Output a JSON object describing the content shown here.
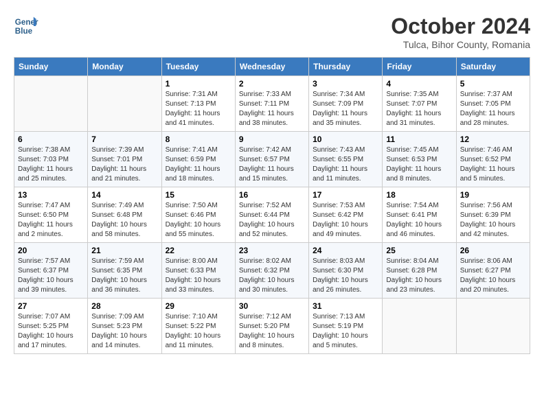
{
  "header": {
    "logo_line1": "General",
    "logo_line2": "Blue",
    "month": "October 2024",
    "location": "Tulca, Bihor County, Romania"
  },
  "weekdays": [
    "Sunday",
    "Monday",
    "Tuesday",
    "Wednesday",
    "Thursday",
    "Friday",
    "Saturday"
  ],
  "weeks": [
    [
      {
        "day": "",
        "sunrise": "",
        "sunset": "",
        "daylight": ""
      },
      {
        "day": "",
        "sunrise": "",
        "sunset": "",
        "daylight": ""
      },
      {
        "day": "1",
        "sunrise": "Sunrise: 7:31 AM",
        "sunset": "Sunset: 7:13 PM",
        "daylight": "Daylight: 11 hours and 41 minutes."
      },
      {
        "day": "2",
        "sunrise": "Sunrise: 7:33 AM",
        "sunset": "Sunset: 7:11 PM",
        "daylight": "Daylight: 11 hours and 38 minutes."
      },
      {
        "day": "3",
        "sunrise": "Sunrise: 7:34 AM",
        "sunset": "Sunset: 7:09 PM",
        "daylight": "Daylight: 11 hours and 35 minutes."
      },
      {
        "day": "4",
        "sunrise": "Sunrise: 7:35 AM",
        "sunset": "Sunset: 7:07 PM",
        "daylight": "Daylight: 11 hours and 31 minutes."
      },
      {
        "day": "5",
        "sunrise": "Sunrise: 7:37 AM",
        "sunset": "Sunset: 7:05 PM",
        "daylight": "Daylight: 11 hours and 28 minutes."
      }
    ],
    [
      {
        "day": "6",
        "sunrise": "Sunrise: 7:38 AM",
        "sunset": "Sunset: 7:03 PM",
        "daylight": "Daylight: 11 hours and 25 minutes."
      },
      {
        "day": "7",
        "sunrise": "Sunrise: 7:39 AM",
        "sunset": "Sunset: 7:01 PM",
        "daylight": "Daylight: 11 hours and 21 minutes."
      },
      {
        "day": "8",
        "sunrise": "Sunrise: 7:41 AM",
        "sunset": "Sunset: 6:59 PM",
        "daylight": "Daylight: 11 hours and 18 minutes."
      },
      {
        "day": "9",
        "sunrise": "Sunrise: 7:42 AM",
        "sunset": "Sunset: 6:57 PM",
        "daylight": "Daylight: 11 hours and 15 minutes."
      },
      {
        "day": "10",
        "sunrise": "Sunrise: 7:43 AM",
        "sunset": "Sunset: 6:55 PM",
        "daylight": "Daylight: 11 hours and 11 minutes."
      },
      {
        "day": "11",
        "sunrise": "Sunrise: 7:45 AM",
        "sunset": "Sunset: 6:53 PM",
        "daylight": "Daylight: 11 hours and 8 minutes."
      },
      {
        "day": "12",
        "sunrise": "Sunrise: 7:46 AM",
        "sunset": "Sunset: 6:52 PM",
        "daylight": "Daylight: 11 hours and 5 minutes."
      }
    ],
    [
      {
        "day": "13",
        "sunrise": "Sunrise: 7:47 AM",
        "sunset": "Sunset: 6:50 PM",
        "daylight": "Daylight: 11 hours and 2 minutes."
      },
      {
        "day": "14",
        "sunrise": "Sunrise: 7:49 AM",
        "sunset": "Sunset: 6:48 PM",
        "daylight": "Daylight: 10 hours and 58 minutes."
      },
      {
        "day": "15",
        "sunrise": "Sunrise: 7:50 AM",
        "sunset": "Sunset: 6:46 PM",
        "daylight": "Daylight: 10 hours and 55 minutes."
      },
      {
        "day": "16",
        "sunrise": "Sunrise: 7:52 AM",
        "sunset": "Sunset: 6:44 PM",
        "daylight": "Daylight: 10 hours and 52 minutes."
      },
      {
        "day": "17",
        "sunrise": "Sunrise: 7:53 AM",
        "sunset": "Sunset: 6:42 PM",
        "daylight": "Daylight: 10 hours and 49 minutes."
      },
      {
        "day": "18",
        "sunrise": "Sunrise: 7:54 AM",
        "sunset": "Sunset: 6:41 PM",
        "daylight": "Daylight: 10 hours and 46 minutes."
      },
      {
        "day": "19",
        "sunrise": "Sunrise: 7:56 AM",
        "sunset": "Sunset: 6:39 PM",
        "daylight": "Daylight: 10 hours and 42 minutes."
      }
    ],
    [
      {
        "day": "20",
        "sunrise": "Sunrise: 7:57 AM",
        "sunset": "Sunset: 6:37 PM",
        "daylight": "Daylight: 10 hours and 39 minutes."
      },
      {
        "day": "21",
        "sunrise": "Sunrise: 7:59 AM",
        "sunset": "Sunset: 6:35 PM",
        "daylight": "Daylight: 10 hours and 36 minutes."
      },
      {
        "day": "22",
        "sunrise": "Sunrise: 8:00 AM",
        "sunset": "Sunset: 6:33 PM",
        "daylight": "Daylight: 10 hours and 33 minutes."
      },
      {
        "day": "23",
        "sunrise": "Sunrise: 8:02 AM",
        "sunset": "Sunset: 6:32 PM",
        "daylight": "Daylight: 10 hours and 30 minutes."
      },
      {
        "day": "24",
        "sunrise": "Sunrise: 8:03 AM",
        "sunset": "Sunset: 6:30 PM",
        "daylight": "Daylight: 10 hours and 26 minutes."
      },
      {
        "day": "25",
        "sunrise": "Sunrise: 8:04 AM",
        "sunset": "Sunset: 6:28 PM",
        "daylight": "Daylight: 10 hours and 23 minutes."
      },
      {
        "day": "26",
        "sunrise": "Sunrise: 8:06 AM",
        "sunset": "Sunset: 6:27 PM",
        "daylight": "Daylight: 10 hours and 20 minutes."
      }
    ],
    [
      {
        "day": "27",
        "sunrise": "Sunrise: 7:07 AM",
        "sunset": "Sunset: 5:25 PM",
        "daylight": "Daylight: 10 hours and 17 minutes."
      },
      {
        "day": "28",
        "sunrise": "Sunrise: 7:09 AM",
        "sunset": "Sunset: 5:23 PM",
        "daylight": "Daylight: 10 hours and 14 minutes."
      },
      {
        "day": "29",
        "sunrise": "Sunrise: 7:10 AM",
        "sunset": "Sunset: 5:22 PM",
        "daylight": "Daylight: 10 hours and 11 minutes."
      },
      {
        "day": "30",
        "sunrise": "Sunrise: 7:12 AM",
        "sunset": "Sunset: 5:20 PM",
        "daylight": "Daylight: 10 hours and 8 minutes."
      },
      {
        "day": "31",
        "sunrise": "Sunrise: 7:13 AM",
        "sunset": "Sunset: 5:19 PM",
        "daylight": "Daylight: 10 hours and 5 minutes."
      },
      {
        "day": "",
        "sunrise": "",
        "sunset": "",
        "daylight": ""
      },
      {
        "day": "",
        "sunrise": "",
        "sunset": "",
        "daylight": ""
      }
    ]
  ]
}
